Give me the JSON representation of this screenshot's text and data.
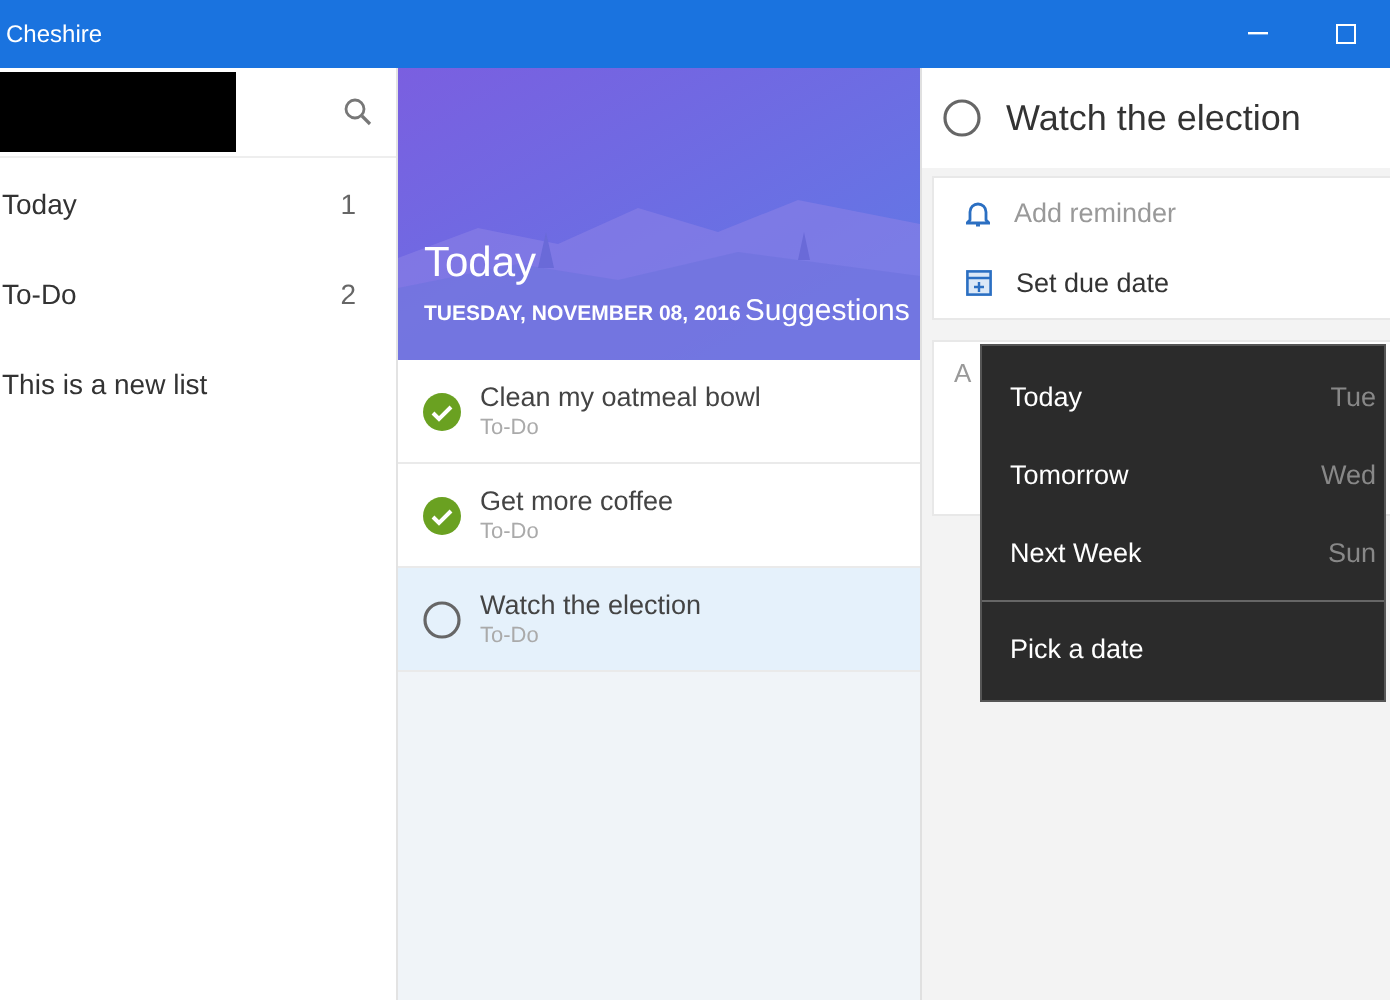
{
  "window": {
    "title": "Cheshire"
  },
  "sidebar": {
    "items": [
      {
        "label": "Today",
        "count": "1",
        "selected": false
      },
      {
        "label": "To-Do",
        "count": "2",
        "selected": false
      },
      {
        "label": "This is a new list",
        "selected": false
      }
    ]
  },
  "list_header": {
    "title": "Today",
    "date": "TUESDAY, NOVEMBER 08, 2016",
    "suggestions": "Suggestions"
  },
  "tasks": [
    {
      "title": "Clean my oatmeal bowl",
      "list": "To-Do",
      "checked": true,
      "selected": false
    },
    {
      "title": "Get more coffee",
      "list": "To-Do",
      "checked": true,
      "selected": false
    },
    {
      "title": "Watch the election",
      "list": "To-Do",
      "checked": false,
      "selected": true
    }
  ],
  "detail": {
    "title": "Watch the election",
    "checked": false,
    "reminder": "Add reminder",
    "due_date": "Set due date",
    "note_partial": "A"
  },
  "due_menu": {
    "items": [
      {
        "label": "Today",
        "day": "Tue"
      },
      {
        "label": "Tomorrow",
        "day": "Wed"
      },
      {
        "label": "Next Week",
        "day": "Sun"
      }
    ],
    "pick": "Pick a date"
  }
}
